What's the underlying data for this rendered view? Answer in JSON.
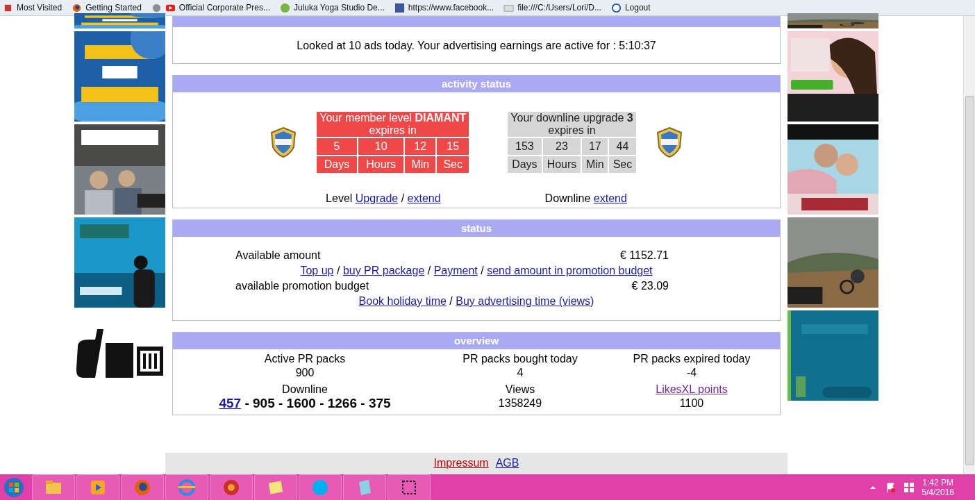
{
  "bookmarks": [
    "Most Visited",
    "Getting Started",
    "Official Corporate Pres...",
    "Juluka Yoga Studio De...",
    "https://www.facebook...",
    "file:///C:/Users/Lori/D...",
    "Logout"
  ],
  "earnings": {
    "text": "Looked at 10 ads today. Your advertising earnings are active for : 5:10:37"
  },
  "activity": {
    "title": "activity status",
    "member": {
      "title": "Your member level **DIAMANT**",
      "subtitle": "expires in",
      "values": [
        "5",
        "10",
        "12",
        "15"
      ],
      "units": [
        "Days",
        "Hours",
        "Min",
        "Sec"
      ]
    },
    "downline": {
      "title": "Your downline upgrade **3**",
      "subtitle": "expires in",
      "values": [
        "153",
        "23",
        "17",
        "44"
      ],
      "units": [
        "Days",
        "Hours",
        "Min",
        "Sec"
      ]
    },
    "separator": "/",
    "level_label": "Level",
    "level_links": [
      "Upgrade",
      "extend"
    ],
    "downline_label": "Downline",
    "downline_link": "extend"
  },
  "status": {
    "title": "status",
    "separator": "/",
    "rows": [
      {
        "label": "Available amount",
        "value": "€ 1152.71",
        "links": [
          "Top up",
          "buy PR package",
          "Payment",
          "send amount in promotion budget"
        ]
      },
      {
        "label": "available promotion budget",
        "value": "€ 23.09",
        "links": [
          "Book holiday time",
          "Buy advertising time (views)"
        ]
      }
    ]
  },
  "overview": {
    "title": "overview",
    "cells": [
      {
        "label": "Active PR packs",
        "value": "900"
      },
      {
        "label": "PR packs bought today",
        "value": "4"
      },
      {
        "label": "PR packs expired today",
        "value": "-4"
      }
    ],
    "downline": {
      "label": "Downline",
      "link": "457",
      "rest": " - 905 - 1600 - 1266 - 375"
    },
    "views": {
      "label": "Views",
      "value": "1358249"
    },
    "points": {
      "link": "LikesXL points",
      "value": "1100"
    }
  },
  "footer": [
    "Impressum",
    "AGB"
  ],
  "clock": {
    "time": "1:42 PM",
    "date": "5/4/2016"
  }
}
